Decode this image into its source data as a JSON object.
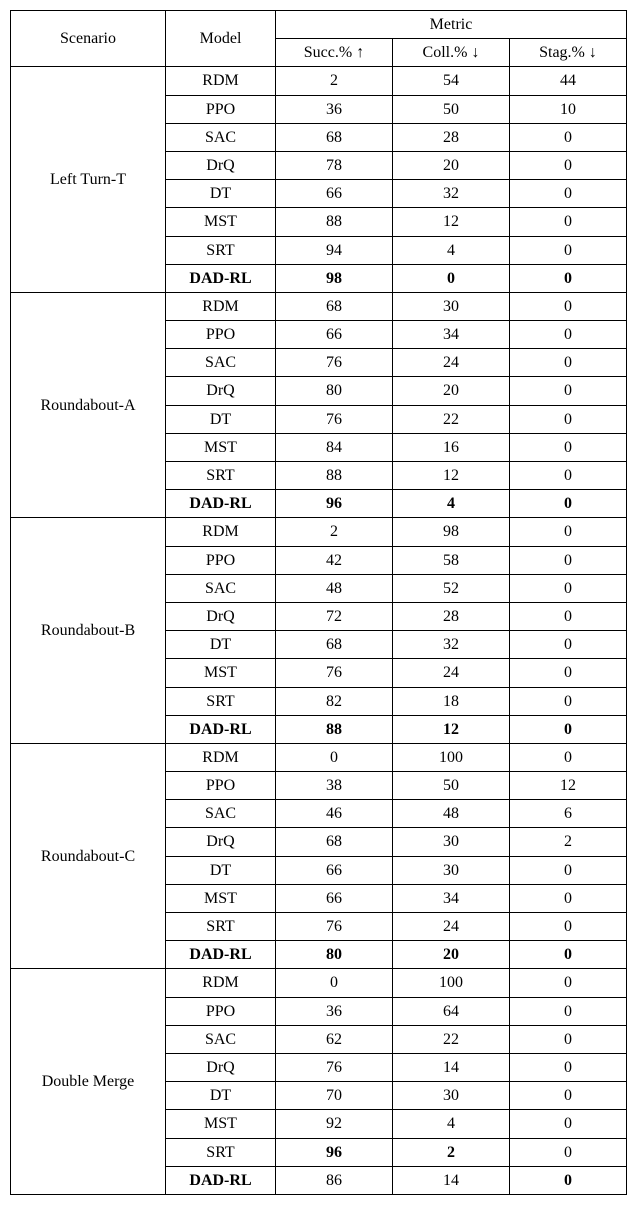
{
  "headers": {
    "scenario": "Scenario",
    "model": "Model",
    "metric_group": "Metric",
    "succ": "Succ.% ↑",
    "coll": "Coll.% ↓",
    "stag": "Stag.% ↓"
  },
  "groups": [
    {
      "scenario": "Left Turn-T",
      "rows": [
        {
          "model": "RDM",
          "succ": "2",
          "coll": "54",
          "stag": "44",
          "bold": false
        },
        {
          "model": "PPO",
          "succ": "36",
          "coll": "50",
          "stag": "10",
          "bold": false
        },
        {
          "model": "SAC",
          "succ": "68",
          "coll": "28",
          "stag": "0",
          "bold": false
        },
        {
          "model": "DrQ",
          "succ": "78",
          "coll": "20",
          "stag": "0",
          "bold": false
        },
        {
          "model": "DT",
          "succ": "66",
          "coll": "32",
          "stag": "0",
          "bold": false
        },
        {
          "model": "MST",
          "succ": "88",
          "coll": "12",
          "stag": "0",
          "bold": false
        },
        {
          "model": "SRT",
          "succ": "94",
          "coll": "4",
          "stag": "0",
          "bold": false
        },
        {
          "model": "DAD-RL",
          "succ": "98",
          "coll": "0",
          "stag": "0",
          "bold": true
        }
      ]
    },
    {
      "scenario": "Roundabout-A",
      "rows": [
        {
          "model": "RDM",
          "succ": "68",
          "coll": "30",
          "stag": "0",
          "bold": false
        },
        {
          "model": "PPO",
          "succ": "66",
          "coll": "34",
          "stag": "0",
          "bold": false
        },
        {
          "model": "SAC",
          "succ": "76",
          "coll": "24",
          "stag": "0",
          "bold": false
        },
        {
          "model": "DrQ",
          "succ": "80",
          "coll": "20",
          "stag": "0",
          "bold": false
        },
        {
          "model": "DT",
          "succ": "76",
          "coll": "22",
          "stag": "0",
          "bold": false
        },
        {
          "model": "MST",
          "succ": "84",
          "coll": "16",
          "stag": "0",
          "bold": false
        },
        {
          "model": "SRT",
          "succ": "88",
          "coll": "12",
          "stag": "0",
          "bold": false
        },
        {
          "model": "DAD-RL",
          "succ": "96",
          "coll": "4",
          "stag": "0",
          "bold": true
        }
      ]
    },
    {
      "scenario": "Roundabout-B",
      "rows": [
        {
          "model": "RDM",
          "succ": "2",
          "coll": "98",
          "stag": "0",
          "bold": false
        },
        {
          "model": "PPO",
          "succ": "42",
          "coll": "58",
          "stag": "0",
          "bold": false
        },
        {
          "model": "SAC",
          "succ": "48",
          "coll": "52",
          "stag": "0",
          "bold": false
        },
        {
          "model": "DrQ",
          "succ": "72",
          "coll": "28",
          "stag": "0",
          "bold": false
        },
        {
          "model": "DT",
          "succ": "68",
          "coll": "32",
          "stag": "0",
          "bold": false
        },
        {
          "model": "MST",
          "succ": "76",
          "coll": "24",
          "stag": "0",
          "bold": false
        },
        {
          "model": "SRT",
          "succ": "82",
          "coll": "18",
          "stag": "0",
          "bold": false
        },
        {
          "model": "DAD-RL",
          "succ": "88",
          "coll": "12",
          "stag": "0",
          "bold": true
        }
      ]
    },
    {
      "scenario": "Roundabout-C",
      "rows": [
        {
          "model": "RDM",
          "succ": "0",
          "coll": "100",
          "stag": "0",
          "bold": false
        },
        {
          "model": "PPO",
          "succ": "38",
          "coll": "50",
          "stag": "12",
          "bold": false
        },
        {
          "model": "SAC",
          "succ": "46",
          "coll": "48",
          "stag": "6",
          "bold": false
        },
        {
          "model": "DrQ",
          "succ": "68",
          "coll": "30",
          "stag": "2",
          "bold": false
        },
        {
          "model": "DT",
          "succ": "66",
          "coll": "30",
          "stag": "0",
          "bold": false
        },
        {
          "model": "MST",
          "succ": "66",
          "coll": "34",
          "stag": "0",
          "bold": false
        },
        {
          "model": "SRT",
          "succ": "76",
          "coll": "24",
          "stag": "0",
          "bold": false
        },
        {
          "model": "DAD-RL",
          "succ": "80",
          "coll": "20",
          "stag": "0",
          "bold": true
        }
      ]
    },
    {
      "scenario": "Double Merge",
      "rows": [
        {
          "model": "RDM",
          "succ": "0",
          "coll": "100",
          "stag": "0",
          "bold": false
        },
        {
          "model": "PPO",
          "succ": "36",
          "coll": "64",
          "stag": "0",
          "bold": false
        },
        {
          "model": "SAC",
          "succ": "62",
          "coll": "22",
          "stag": "0",
          "bold": false
        },
        {
          "model": "DrQ",
          "succ": "76",
          "coll": "14",
          "stag": "0",
          "bold": false
        },
        {
          "model": "DT",
          "succ": "70",
          "coll": "30",
          "stag": "0",
          "bold": false
        },
        {
          "model": "MST",
          "succ": "92",
          "coll": "4",
          "stag": "0",
          "bold": false
        },
        {
          "model": "SRT",
          "succ": "96",
          "coll": "2",
          "stag": "0",
          "bold": true,
          "bold_model": false,
          "bold_stag": false
        },
        {
          "model": "DAD-RL",
          "succ": "86",
          "coll": "14",
          "stag": "0",
          "bold": false,
          "bold_model": true,
          "bold_stag": true
        }
      ]
    }
  ]
}
